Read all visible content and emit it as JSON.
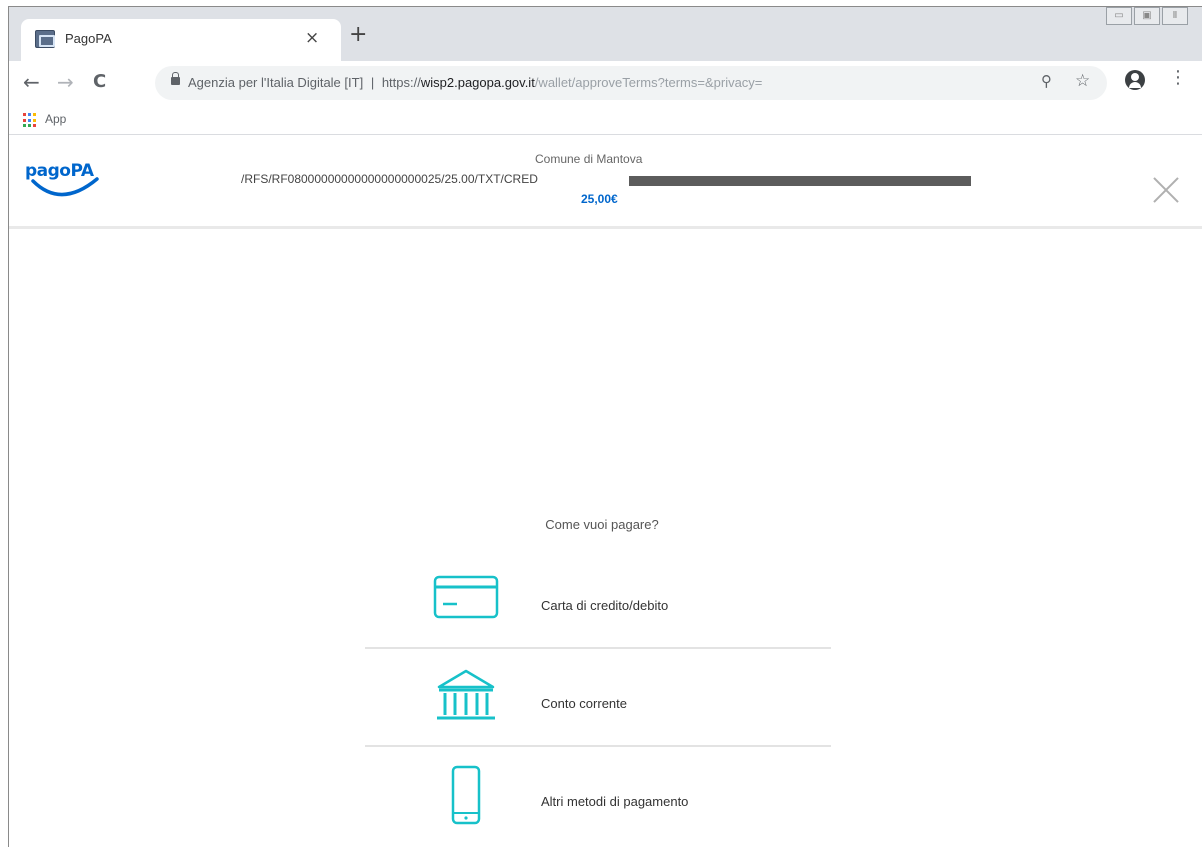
{
  "browser": {
    "tab_title": "PagoPA",
    "tab_close_glyph": "×",
    "new_tab_glyph": "+",
    "back_glyph": "←",
    "forward_glyph": "→",
    "reload_glyph": "C",
    "url_identity": "Agenzia per l'Italia Digitale [IT]",
    "url_separator": "|",
    "url_scheme": "https://",
    "url_host": "wisp2.pagopa.gov.it",
    "url_path": "/wallet/approveTerms?terms=&privacy=",
    "zoom_glyph": "⚲",
    "star_glyph": "☆",
    "menu_glyph": "⋮",
    "bookmarks": {
      "apps_label": "App"
    },
    "window_controls": [
      "▭",
      "▣",
      "Ⅱ"
    ]
  },
  "header": {
    "logo_text": "pagoPA",
    "entity": "Comune di Mantova",
    "description": "/RFS/RF08000000000000000000025/25.00/TXT/CRED",
    "amount": "25,00€"
  },
  "chooser": {
    "question": "Come vuoi pagare?",
    "methods": [
      {
        "label": "Carta di credito/debito",
        "icon": "credit-card-icon"
      },
      {
        "label": "Conto corrente",
        "icon": "bank-icon"
      },
      {
        "label": "Altri metodi di pagamento",
        "icon": "smartphone-icon"
      }
    ]
  },
  "colors": {
    "brand_blue": "#0066cc",
    "icon_teal": "#17c1c9"
  }
}
